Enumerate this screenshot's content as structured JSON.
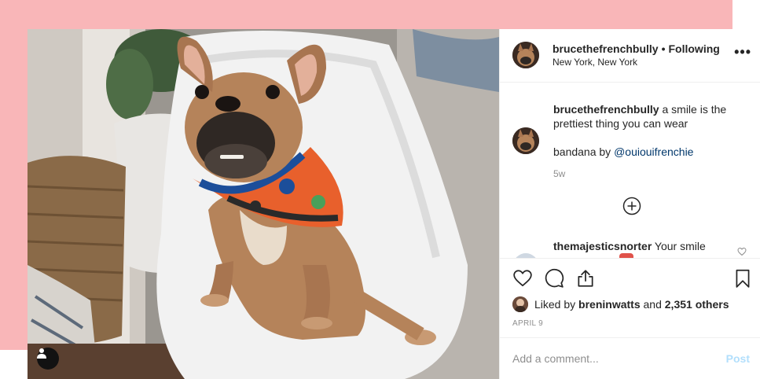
{
  "post": {
    "author": {
      "username": "brucethefrenchbully",
      "separator": "•",
      "follow_status": "Following",
      "location": "New York, New York"
    },
    "more_label": "•••",
    "caption": {
      "username": "brucethefrenchbully",
      "text": "a smile is the prettiest thing you can wear",
      "line2_prefix": "bandana by",
      "mention": "@ouiouifrenchie",
      "time_ago": "5w"
    },
    "reply": {
      "username": "themajesticsnorter",
      "text": "Your smile"
    },
    "likes": {
      "prefix": "Liked by",
      "user": "breninwatts",
      "joiner": "and",
      "others": "2,351 others"
    },
    "date": "APRIL 9",
    "add_comment": {
      "placeholder": "Add a comment...",
      "post_label": "Post"
    }
  },
  "icons": {
    "like": "heart-icon",
    "comment": "speech-bubble-icon",
    "share": "share-icon",
    "save": "bookmark-icon",
    "load_more": "plus-circle-icon",
    "user_tag": "person-icon"
  },
  "colors": {
    "background_accent": "#f9b6b8",
    "mention": "#00376b",
    "post_button_disabled": "#b2dffc",
    "muted_text": "#8e8e8e"
  }
}
